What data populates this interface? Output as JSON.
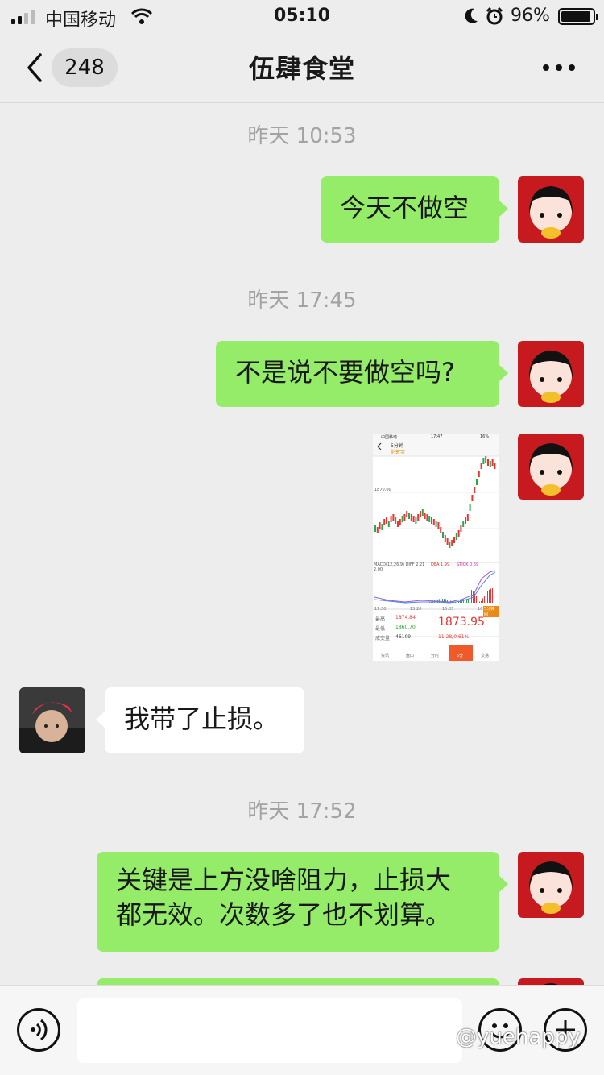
{
  "status_bar": {
    "carrier": "中国移动",
    "time": "05:10",
    "battery": "96%"
  },
  "nav": {
    "unread_count": "248",
    "title": "伍肆食堂"
  },
  "messages": {
    "time1": "昨天 10:53",
    "msg1": "今天不做空",
    "time2": "昨天 17:45",
    "msg2": "不是说不要做空吗?",
    "msg3": "我带了止损。",
    "time3": "昨天 17:52",
    "msg4_line1": "关键是上方没啥阻力，止损大",
    "msg4_line2": "都无效。次数多了也不划算。"
  },
  "screenshot_thumb": {
    "carrier": "中国移动",
    "time": "17:47",
    "battery": "16%",
    "period": "5分钟",
    "symbol": "伦敦金",
    "level_label": "1870.00",
    "macd_label": "MACD(12,26,9)  DIFF 2.21",
    "dea_label": "DEA 1.99",
    "stick_label": "STICK 0.59",
    "axis_low": "2.00",
    "t1": "11:30",
    "t2": "13:20",
    "t3": "15:05",
    "t4": "16:",
    "open_label": "最高",
    "open_val": "1874.84",
    "low_label": "最低",
    "low_val": "1860.70",
    "vol_label": "成交量",
    "vol_val": "46109",
    "price": "1873.95",
    "change": "11.28/0.61%",
    "tab1": "资讯",
    "tab2": "盘口",
    "tab3": "分时",
    "tab4": "5分",
    "tab5": "交易",
    "badge": "5分钟图"
  },
  "input": {
    "watermark": "@yuehappy"
  },
  "colors": {
    "sent_bubble": "#95ec69",
    "recv_bubble": "#ffffff",
    "background": "#ededed"
  }
}
